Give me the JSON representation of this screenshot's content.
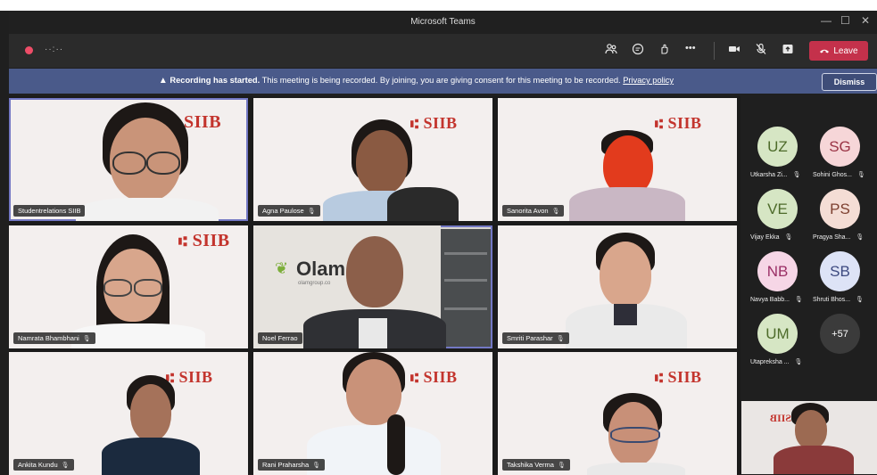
{
  "window": {
    "title": "Microsoft Teams",
    "minimize": "—",
    "maximize": "☐",
    "close": "✕"
  },
  "toolbar": {
    "recording_time": "··:··",
    "icons": [
      "people-icon",
      "chat-icon",
      "reactions-icon",
      "more-icon",
      "camera-icon",
      "mic-off-icon",
      "share-icon"
    ],
    "more_label": "•••",
    "leave_label": "Leave"
  },
  "banner": {
    "bold": "Recording has started.",
    "text": " This meeting is being recorded. By joining, you are giving consent for this meeting to be recorded. ",
    "link": "Privacy policy",
    "dismiss_label": "Dismiss"
  },
  "tiles": [
    {
      "name": "Studentrelations SIIB",
      "logo": "SIIB"
    },
    {
      "name": "Agna Paulose",
      "logo": "SIIB"
    },
    {
      "name": "Sanorita Avon",
      "logo": "SIIB"
    },
    {
      "name": "Namrata Bhambhani",
      "logo": "SIIB"
    },
    {
      "name": "Noel Ferrao",
      "logo": "Olam",
      "logo_sub": "olamgroup.co"
    },
    {
      "name": "Smriti Parashar",
      "logo": ""
    },
    {
      "name": "Ankita Kundu",
      "logo": "SIIB"
    },
    {
      "name": "Rani Praharsha",
      "logo": "SIIB"
    },
    {
      "name": "Takshika Verma",
      "logo": "SIIB"
    }
  ],
  "roster": [
    {
      "initials": "UZ",
      "name": "Utkarsha Zi...",
      "bg": "#d6e6c4",
      "fg": "#4d6b2a"
    },
    {
      "initials": "SG",
      "name": "Sohini Ghos...",
      "bg": "#f6d6d8",
      "fg": "#9a3445"
    },
    {
      "initials": "VE",
      "name": "Vijay Ekka",
      "bg": "#d6e6c4",
      "fg": "#4d6b2a"
    },
    {
      "initials": "PS",
      "name": "Pragya Sha...",
      "bg": "#f4ddd5",
      "fg": "#7d4030"
    },
    {
      "initials": "NB",
      "name": "Navya Babb...",
      "bg": "#f6d6e6",
      "fg": "#9a2f66"
    },
    {
      "initials": "SB",
      "name": "Shruti Bhos...",
      "bg": "#dde3f6",
      "fg": "#3d4a80"
    },
    {
      "initials": "UM",
      "name": "Utapreksha ...",
      "bg": "#d6e6c4",
      "fg": "#4d6b2a"
    },
    {
      "initials": "+57",
      "name": "",
      "bg": "#3b3b3b",
      "fg": "#ffffff"
    }
  ],
  "selfview": {
    "logo": "SIIB"
  },
  "colors": {
    "accent": "#c4314b",
    "banner": "#4a5a8a",
    "brand": "#c3342d"
  }
}
